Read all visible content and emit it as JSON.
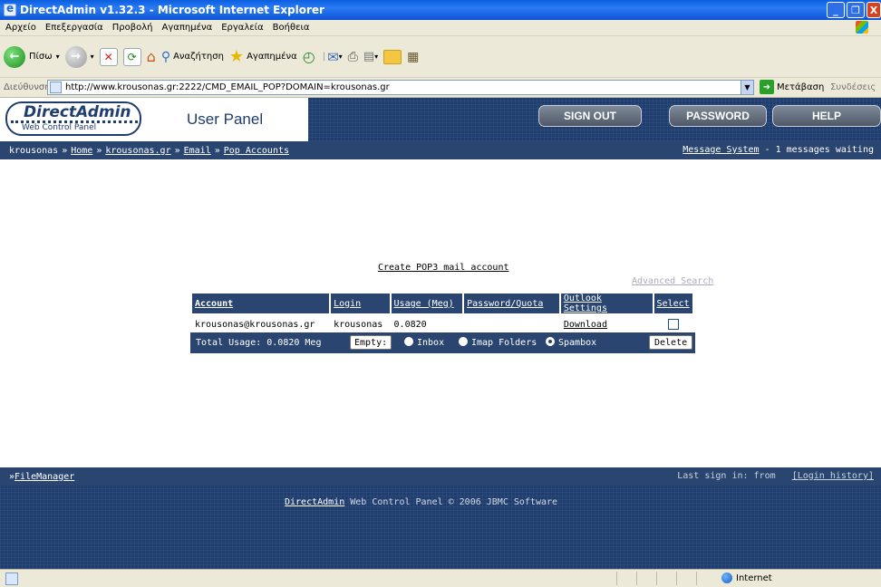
{
  "window": {
    "title": "DirectAdmin v1.32.3 - Microsoft Internet Explorer",
    "controls": {
      "minimize": "_",
      "maximize": "❐",
      "close": "X"
    }
  },
  "menubar": {
    "items": [
      "Αρχείο",
      "Επεξεργασία",
      "Προβολή",
      "Αγαπημένα",
      "Εργαλεία",
      "Βοήθεια"
    ]
  },
  "toolbar": {
    "back_label": "Πίσω",
    "search_label": "Αναζήτηση",
    "favorites_label": "Αγαπημένα"
  },
  "addressbar": {
    "label": "Διεύθυνση",
    "url": "http://www.krousonas.gr:2222/CMD_EMAIL_POP?DOMAIN=krousonas.gr",
    "go_label": "Μετάβαση",
    "links_label": "Συνδέσεις"
  },
  "header": {
    "logo_title": "DirectAdmin",
    "logo_subtitle": "Web Control Panel",
    "panel_title": "User Panel",
    "signout_label": "SIGN OUT",
    "password_label": "PASSWORD",
    "help_label": "HELP"
  },
  "breadcrumb": {
    "user": "krousonas",
    "sep": "»",
    "items": [
      "Home",
      "krousonas.gr",
      "Email",
      "Pop Accounts"
    ],
    "message_link": "Message System",
    "message_status": " - 1 messages waiting"
  },
  "main": {
    "create_link": "Create POP3 mail account",
    "advanced_search": "Advanced Search",
    "table": {
      "headers": [
        "Account",
        "Login",
        "Usage (Meg)",
        "Password/Quota",
        "Outlook Settings",
        "Select"
      ],
      "rows": [
        {
          "account": "krousonas@krousonas.gr",
          "login": "krousonas",
          "usage": "0.0820",
          "password_quota": "",
          "outlook": "Download"
        }
      ]
    },
    "total_usage": "Total Usage: 0.0820 Meg",
    "empty_label": "Empty:",
    "options": [
      "Inbox",
      "Imap Folders",
      "Spambox"
    ],
    "selected_option": "Spambox",
    "delete_label": "Delete"
  },
  "footer": {
    "filemanager_prefix": "» ",
    "filemanager_link": "FileManager",
    "last_sign_in": "Last sign in:   from",
    "login_history": "[Login history]",
    "copyright_link": "DirectAdmin",
    "copyright_text": " Web Control Panel © 2006 JBMC Software"
  },
  "statusbar": {
    "zone": "Internet"
  },
  "colors": {
    "da_dark_blue": "#1f3d6e",
    "da_bar_blue": "#2a4670"
  }
}
